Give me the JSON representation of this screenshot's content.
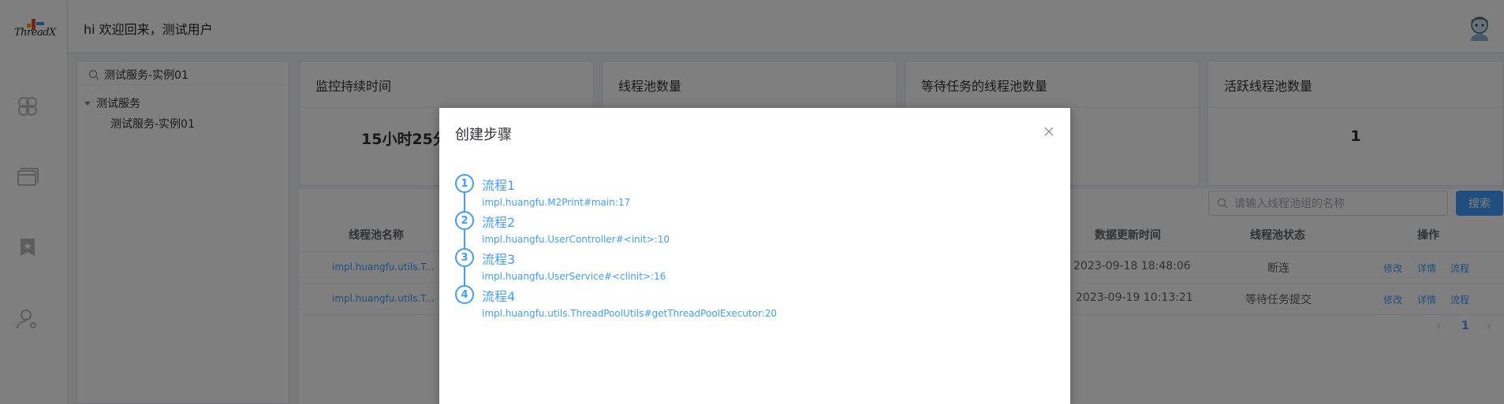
{
  "app": {
    "logo_text": "ThreadX"
  },
  "header": {
    "greeting": "hi 欢迎回来，测试用户"
  },
  "tree": {
    "search_value": "测试服务-实例01",
    "group_label": "测试服务",
    "child_label": "测试服务-实例01"
  },
  "cards": [
    {
      "title": "监控持续时间",
      "value": "15小时25分"
    },
    {
      "title": "线程池数量",
      "value": ""
    },
    {
      "title": "等待任务的线程池数量",
      "value": ""
    },
    {
      "title": "活跃线程池数量",
      "value": "1"
    }
  ],
  "table": {
    "search_placeholder": "请输入线程池组的名称",
    "search_button": "搜索",
    "headers": {
      "name": "线程池名称",
      "updated": "数据更新时间",
      "status": "线程池状态",
      "actions": "操作"
    },
    "rows": [
      {
        "name": "impl.huangfu.utils.T...",
        "updated": "2023-09-18 18:48:06",
        "status": "断连",
        "edit": "修改",
        "detail": "详情",
        "flow": "流程"
      },
      {
        "name": "impl.huangfu.utils.T...",
        "updated": "2023-09-19 10:13:21",
        "status": "等待任务提交",
        "edit": "修改",
        "detail": "详情",
        "flow": "流程"
      }
    ],
    "pager": {
      "prev": "‹",
      "page": "1",
      "next": "›"
    }
  },
  "dialog": {
    "title": "创建步骤",
    "close_icon": "close-icon",
    "steps": [
      {
        "num": "1",
        "title": "流程1",
        "desc": "impl.huangfu.M2Print#main:17"
      },
      {
        "num": "2",
        "title": "流程2",
        "desc": "impl.huangfu.UserController#<init>:10"
      },
      {
        "num": "3",
        "title": "流程3",
        "desc": "impl.huangfu.UserService#<clinit>:16"
      },
      {
        "num": "4",
        "title": "流程4",
        "desc": "impl.huangfu.utils.ThreadPoolUtils#getThreadPoolExecutor:20"
      }
    ]
  },
  "colors": {
    "primary": "#409eff",
    "overlay": "rgba(0,0,0,0.5)"
  }
}
